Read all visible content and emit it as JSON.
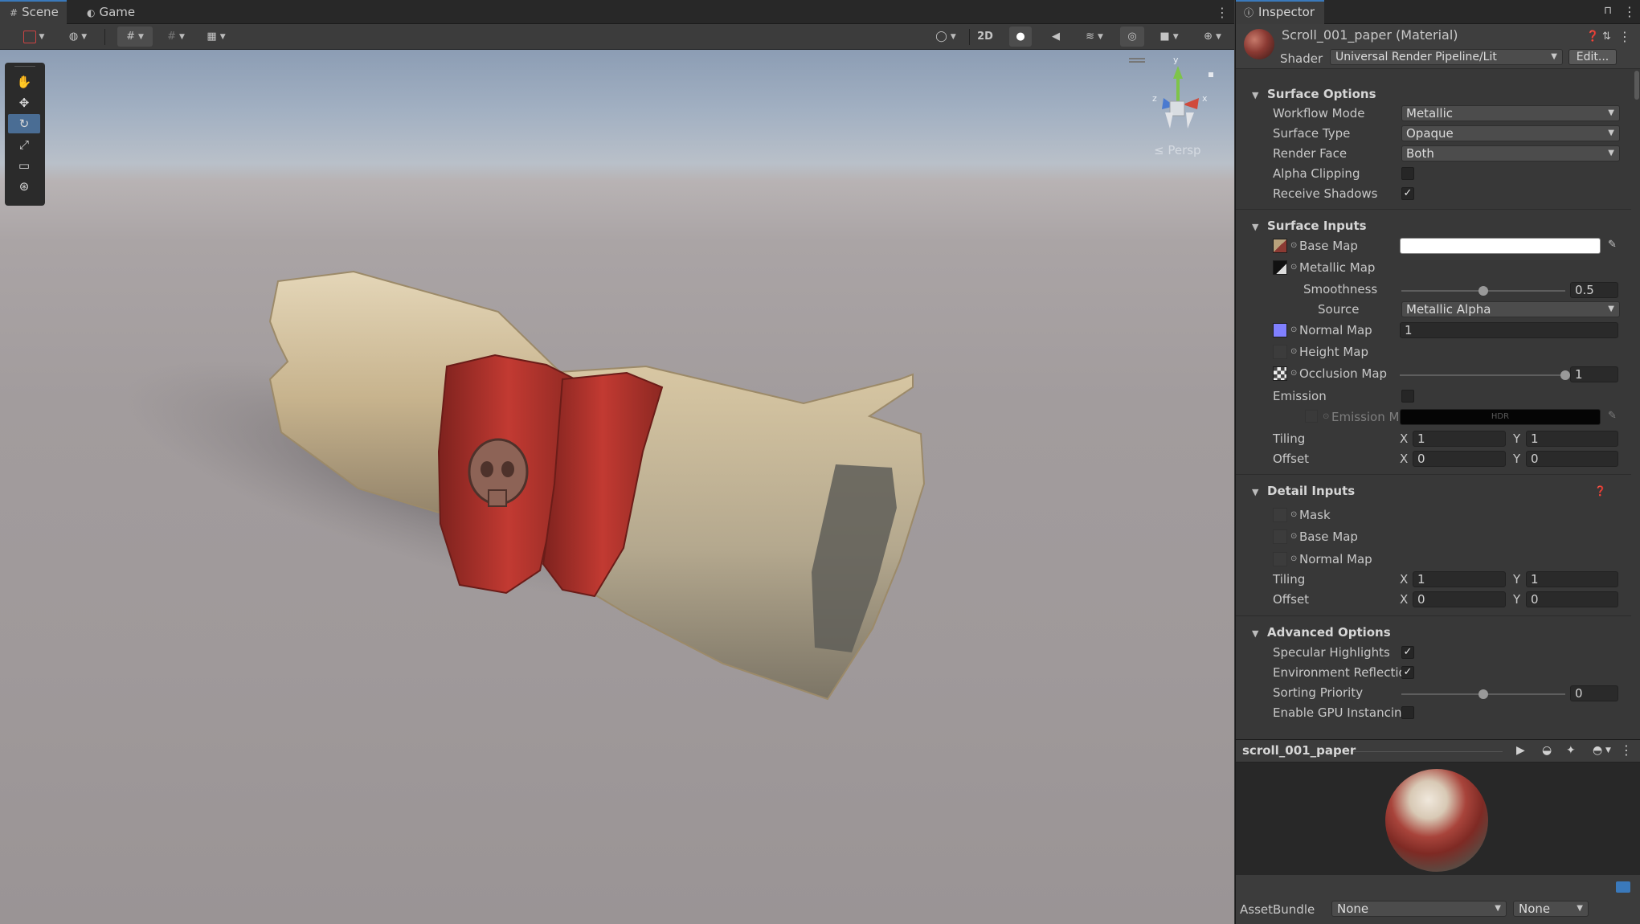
{
  "scene": {
    "tabs": [
      {
        "label": "Scene",
        "icon": "grid-icon"
      },
      {
        "label": "Game",
        "icon": "gamepad-icon"
      }
    ],
    "toolbar": {
      "twod_label": "2D"
    },
    "tools": [
      "hand-tool",
      "move-tool",
      "rotate-tool",
      "scale-tool",
      "rect-tool",
      "transform-tool"
    ],
    "active_tool": "rotate-tool",
    "gizmo": {
      "y_label": "y",
      "x_label": "x",
      "z_label": "z",
      "persp_label": "≤ Persp"
    }
  },
  "inspector": {
    "tab_label": "Inspector",
    "material_title": "Scroll_001_paper (Material)",
    "shader_label": "Shader",
    "shader_value": "Universal Render Pipeline/Lit",
    "edit_label": "Edit...",
    "surface_options": {
      "title": "Surface Options",
      "workflow_mode": {
        "label": "Workflow Mode",
        "value": "Metallic"
      },
      "surface_type": {
        "label": "Surface Type",
        "value": "Opaque"
      },
      "render_face": {
        "label": "Render Face",
        "value": "Both"
      },
      "alpha_clipping": {
        "label": "Alpha Clipping",
        "checked": false
      },
      "receive_shadows": {
        "label": "Receive Shadows",
        "checked": true,
        "mark": "✓"
      }
    },
    "surface_inputs": {
      "title": "Surface Inputs",
      "base_map": "Base Map",
      "metallic_map": "Metallic Map",
      "smoothness": {
        "label": "Smoothness",
        "value": "0.5",
        "fraction": 0.5
      },
      "source": {
        "label": "Source",
        "value": "Metallic Alpha"
      },
      "normal_map": {
        "label": "Normal Map",
        "value": "1"
      },
      "height_map": "Height Map",
      "occlusion_map": {
        "label": "Occlusion Map",
        "value": "1",
        "fraction": 1.0
      },
      "emission": {
        "label": "Emission",
        "checked": false
      },
      "emission_map": {
        "label": "Emission M",
        "hdr": "HDR"
      },
      "tiling": {
        "label": "Tiling",
        "x": "1",
        "y": "1"
      },
      "offset": {
        "label": "Offset",
        "x": "0",
        "y": "0"
      },
      "x_label": "X",
      "y_label": "Y"
    },
    "detail_inputs": {
      "title": "Detail Inputs",
      "mask": "Mask",
      "base_map": "Base Map",
      "normal_map": "Normal Map",
      "tiling": {
        "label": "Tiling",
        "x": "1",
        "y": "1"
      },
      "offset": {
        "label": "Offset",
        "x": "0",
        "y": "0"
      }
    },
    "advanced_options": {
      "title": "Advanced Options",
      "specular_highlights": {
        "label": "Specular Highlights",
        "checked": true
      },
      "environment_reflections": {
        "label": "Environment Reflectio",
        "checked": true
      },
      "sorting_priority": {
        "label": "Sorting Priority",
        "value": "0",
        "fraction": 0.5
      },
      "gpu_instancing": {
        "label": "Enable GPU Instancing",
        "checked": false
      }
    },
    "preview": {
      "name": "scroll_001_paper"
    },
    "assetbundle": {
      "label": "AssetBundle",
      "value1": "None",
      "value2": "None"
    }
  },
  "colors": {
    "accent": "#3a79bb",
    "paper": "#c8b48e",
    "band": "#b2312c"
  }
}
